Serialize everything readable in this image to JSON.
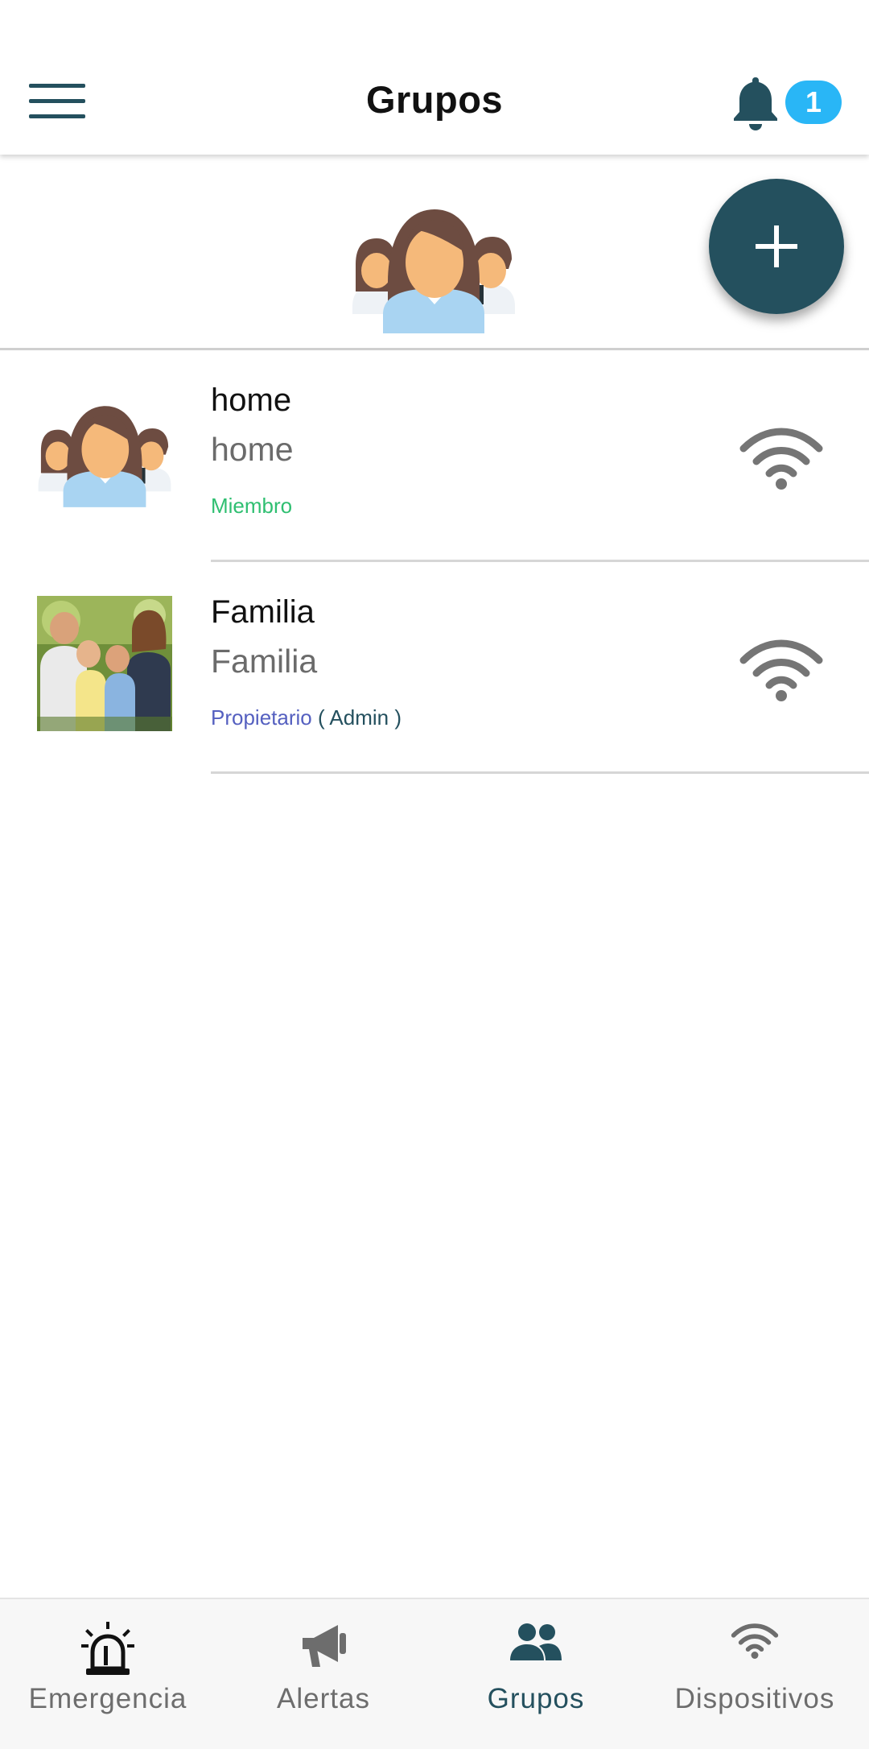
{
  "header": {
    "title": "Grupos",
    "notification_count": "1",
    "menu_icon": "hamburger-menu-icon",
    "bell_icon": "bell-icon"
  },
  "colors": {
    "primary": "#24505e",
    "badge": "#29b6f6",
    "member": "#2fbf71",
    "owner": "#5560c0"
  },
  "fab": {
    "icon": "plus-icon"
  },
  "groups": [
    {
      "name": "home",
      "subtitle": "home",
      "role": "Miembro",
      "role_suffix": "",
      "icon": "wifi-icon"
    },
    {
      "name": "Familia",
      "subtitle": "Familia",
      "role": "Propietario",
      "role_suffix": " ( Admin )",
      "icon": "wifi-icon"
    }
  ],
  "bottom_nav": {
    "items": [
      {
        "label": "Emergencia",
        "icon": "siren-icon",
        "active": false
      },
      {
        "label": "Alertas",
        "icon": "megaphone-icon",
        "active": false
      },
      {
        "label": "Grupos",
        "icon": "people-icon",
        "active": true
      },
      {
        "label": "Dispositivos",
        "icon": "wifi-icon",
        "active": false
      }
    ]
  }
}
